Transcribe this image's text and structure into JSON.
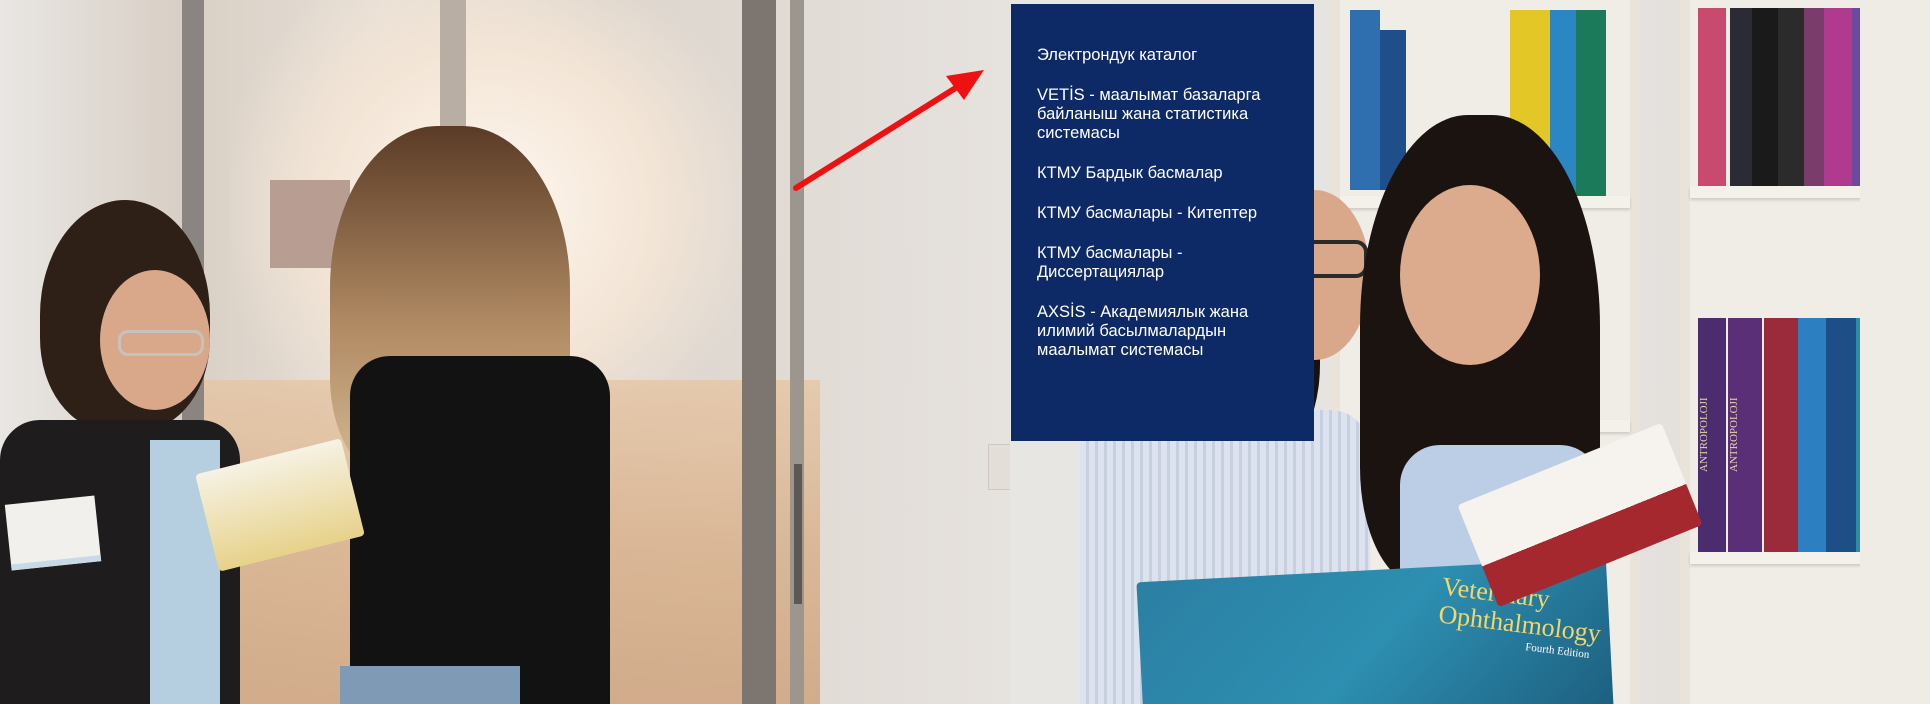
{
  "hero": {
    "image_alt_icon": "library-students-photo",
    "accent": "#0e2a66",
    "arrow_color": "#ee1111"
  },
  "menu": {
    "items": [
      {
        "label": "Электрондук каталог"
      },
      {
        "label": "VETİS - маалымат базаларга байланыш жана статистика системасы"
      },
      {
        "label": "КТМУ Бардык басмалар"
      },
      {
        "label": "КТМУ басмалары - Китептер"
      },
      {
        "label": "КТМУ басмалары - Диссертациялар"
      },
      {
        "label": "AXSİS - Академиялык жана илимий басылмалардын маалымат системасы"
      }
    ]
  },
  "book_cover": {
    "line1": "Veterinary",
    "line2": "Ophthalmology",
    "edition": "Fourth Edition"
  },
  "shelf_books": {
    "spine1": "ANTROPOLOJI",
    "spine2": "ANTROPOLOJI"
  }
}
